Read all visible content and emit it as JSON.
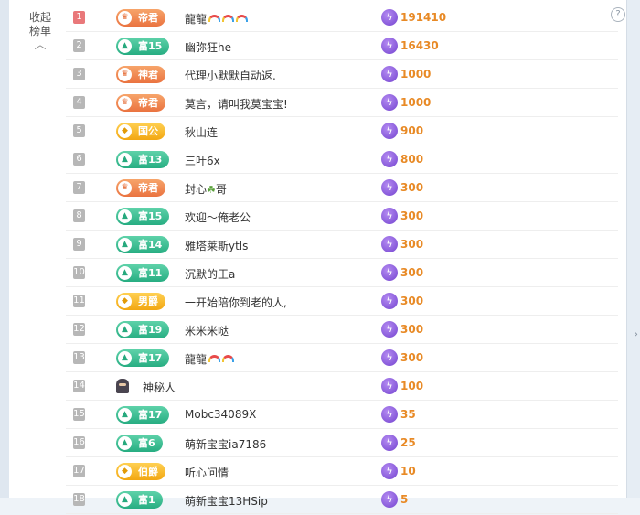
{
  "ui": {
    "collapse_label": "收起\n榜单",
    "collapse_line1": "收起",
    "collapse_line2": "榜单",
    "help_icon": "?"
  },
  "rows": [
    {
      "rank": "1",
      "badge": {
        "kind": "orange",
        "text": "帝君"
      },
      "name": "龍龍",
      "decor": "rainbow3",
      "score": "191410"
    },
    {
      "rank": "2",
      "badge": {
        "kind": "green",
        "text": "富15"
      },
      "name": "幽弥狂he",
      "decor": "",
      "score": "16430"
    },
    {
      "rank": "3",
      "badge": {
        "kind": "orange",
        "text": "神君"
      },
      "name": "代理小默默自动返.",
      "decor": "",
      "score": "1000"
    },
    {
      "rank": "4",
      "badge": {
        "kind": "orange",
        "text": "帝君"
      },
      "name": "莫言，请叫我莫宝宝!",
      "decor": "",
      "score": "1000"
    },
    {
      "rank": "5",
      "badge": {
        "kind": "gold",
        "text": "国公"
      },
      "name": "秋山连",
      "decor": "",
      "score": "900"
    },
    {
      "rank": "6",
      "badge": {
        "kind": "green",
        "text": "富13"
      },
      "name": "三叶6x",
      "decor": "",
      "score": "800"
    },
    {
      "rank": "7",
      "badge": {
        "kind": "orange",
        "text": "帝君"
      },
      "name": "封心",
      "decor": "sprout",
      "name_suffix": "哥",
      "score": "300"
    },
    {
      "rank": "8",
      "badge": {
        "kind": "green",
        "text": "富15"
      },
      "name": "欢迎～俺老公",
      "decor": "",
      "score": "300"
    },
    {
      "rank": "9",
      "badge": {
        "kind": "green",
        "text": "富14"
      },
      "name": "雅塔莱斯ytls",
      "decor": "",
      "score": "300"
    },
    {
      "rank": "10",
      "badge": {
        "kind": "green",
        "text": "富11"
      },
      "name": "沉默的王a",
      "decor": "",
      "score": "300"
    },
    {
      "rank": "11",
      "badge": {
        "kind": "gold",
        "text": "男爵"
      },
      "name": "一开始陪你到老的人,",
      "decor": "",
      "score": "300"
    },
    {
      "rank": "12",
      "badge": {
        "kind": "green",
        "text": "富19"
      },
      "name": "米米米哒",
      "decor": "",
      "score": "300"
    },
    {
      "rank": "13",
      "badge": {
        "kind": "green",
        "text": "富17"
      },
      "name": "龍龍",
      "decor": "rainbow2",
      "score": "300"
    },
    {
      "rank": "14",
      "badge": null,
      "name": "神秘人",
      "decor": "",
      "score": "100"
    },
    {
      "rank": "15",
      "badge": {
        "kind": "green",
        "text": "富17"
      },
      "name": "Mobc34089X",
      "decor": "",
      "score": "35"
    },
    {
      "rank": "16",
      "badge": {
        "kind": "green",
        "text": "富6"
      },
      "name": "萌新宝宝ia7186",
      "decor": "",
      "score": "25"
    },
    {
      "rank": "17",
      "badge": {
        "kind": "gold",
        "text": "伯爵"
      },
      "name": "听心问情",
      "decor": "",
      "score": "10"
    },
    {
      "rank": "18",
      "badge": {
        "kind": "green",
        "text": "富1"
      },
      "name": "萌新宝宝13HSip",
      "decor": "",
      "score": "5"
    }
  ],
  "icons": {
    "noble": "crown-icon",
    "wealth": "wealth-icon",
    "gold": "star-icon",
    "score": "lightning-coin-icon",
    "mystery": "mystery-user-icon",
    "collapse": "chevron-up-icon",
    "help": "help-icon"
  },
  "colors": {
    "orange_badge": "#ea7340",
    "green_badge": "#27ad82",
    "gold_badge": "#f2a712",
    "score_text": "#e88a26",
    "coin": "#7343cf",
    "rank_top": "#e9787a",
    "rank": "#b7b7b7"
  }
}
